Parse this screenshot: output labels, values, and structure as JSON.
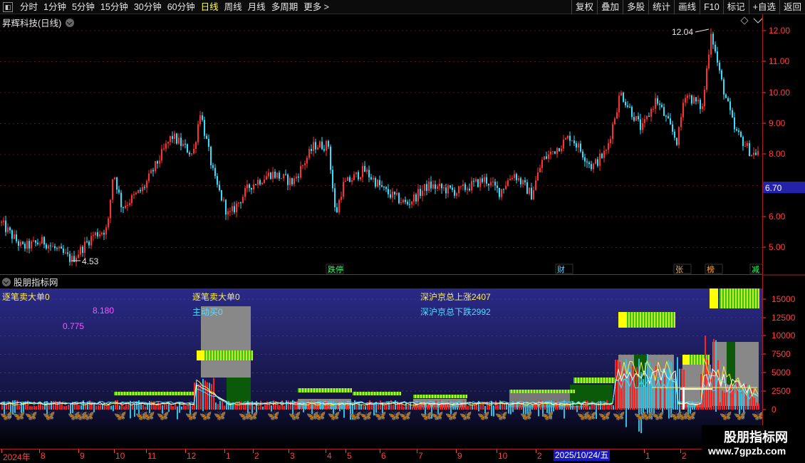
{
  "toolbar": {
    "periods": [
      "分时",
      "1分钟",
      "5分钟",
      "15分钟",
      "30分钟",
      "60分钟",
      "日线",
      "周线",
      "月线",
      "多周期",
      "更多 >"
    ],
    "active_period": "日线",
    "actions": [
      "复权",
      "叠加",
      "多股",
      "统计",
      "画线",
      "F10",
      "标记",
      "+自选",
      "返回"
    ]
  },
  "price_panel": {
    "title": "昇辉科技(日线)",
    "high_label": "12.04",
    "low_label": "4.53",
    "current_price": "6.70",
    "axis_ticks": [
      "12.00",
      "11.00",
      "10.00",
      "9.00",
      "8.00",
      "6.00",
      "5.00"
    ],
    "event_tags": [
      {
        "text": "跌停",
        "color": "#33ff66"
      },
      {
        "text": "财",
        "color": "#66ccff"
      },
      {
        "text": "张",
        "color": "#ffaa33"
      },
      {
        "text": "榜",
        "color": "#ffaa33"
      },
      {
        "text": "减",
        "color": "#33ff66"
      }
    ]
  },
  "indicator_panel": {
    "title": "股朋指标网",
    "labels": {
      "big_sell": "逐笔卖大单0",
      "active_buy": "主动买0",
      "market_up": "深沪京总上涨2407",
      "market_down": "深沪京总下跌2992",
      "value1": "8.180",
      "value2": "0.775"
    },
    "axis_ticks": [
      "15000",
      "12500",
      "10000",
      "7500",
      "5000",
      "2500",
      "0"
    ]
  },
  "time_axis": {
    "labels": [
      "2024年",
      "8",
      "9",
      "10",
      "11",
      "12",
      "1",
      "2",
      "3",
      "4",
      "5",
      "6",
      "7",
      "9",
      "10",
      "2",
      "1",
      "2"
    ],
    "cursor_date": "2025/10/24/五"
  },
  "watermark": {
    "title": "股朋指标网",
    "url": "www.7gpzb.com"
  },
  "colors": {
    "up": "#ff3030",
    "down": "#30e0ff",
    "axis": "#ff4040",
    "indicator_bg_top": "#2a2a88",
    "indicator_bg_bottom": "#000000"
  }
}
